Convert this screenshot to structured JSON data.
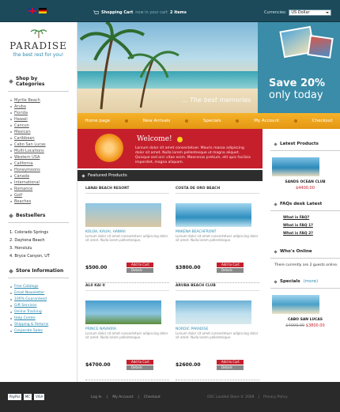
{
  "topbar": {
    "flags": [
      "uk-flag-icon",
      "de-flag-icon"
    ],
    "cart_title": "Shopping Cart",
    "cart_now": "now in your cart",
    "cart_count": "2 items",
    "currency_label": "Currencies:",
    "currency_value": "US Dollar"
  },
  "logo": {
    "brand": "PARADISE",
    "tagline": "the best rest for you!"
  },
  "sidebar": {
    "categories_title": "Shop by Categories",
    "categories": [
      "Myrtle Beach",
      "Aruba",
      "Florida",
      "Hawaii",
      "Cancun",
      "Mexican",
      "Caribbean",
      "Cabo San Lucas",
      "Multi-Locations",
      "Western USA",
      "California",
      "Honeymoons",
      "Canada",
      "International",
      "Romance",
      "Golf",
      "Beaches"
    ],
    "bestsellers_title": "Bestsellers",
    "bestsellers": [
      "1.  Colorado Springs",
      "2.  Daytona Beach",
      "3.  Honolulu",
      "4.  Bryce Canyon, UT"
    ],
    "info_title": "Store Information",
    "info": [
      "Free Catalogs",
      "Email Newsletter",
      "100% Guaranteed",
      "Gift Services",
      "Online Tracking",
      "Help Center",
      "Shipping & Returns",
      "Corporate Sales"
    ]
  },
  "banner": {
    "memories": "... The best memories",
    "save": "Save 20%",
    "only": "only today"
  },
  "nav": [
    "Home page",
    "New Arrivals",
    "Specials",
    "My Account",
    "Checkout"
  ],
  "welcome": {
    "title": "Welcome!",
    "text": "Lorsum dolor sit amet consectetuer. Mauris massa adipiscing dolor sit amet. Nulla lorem pellentesque ut magna aliquet. Quisque sed orci vitae enim. Maecenas pretium, elit quis facilisis imperdiet, magna aliquam."
  },
  "featured": {
    "title": "Featured Products",
    "products": [
      {
        "name": "LANAI BEACH RESORT",
        "desc_title": "KOLOA, KAUAI, HAWAII",
        "desc": "Lorsum dolor sit amet consectetuer adipiscing dolor sit amet. Nulla lorem pellentesque.",
        "price": "$500.00",
        "cart": "Add to Cart",
        "details": "Details",
        "img": [
          "#d9c7a4",
          "#f0e6cf"
        ]
      },
      {
        "name": "COSTA DE ORO BEACH",
        "desc_title": "MAKENA BEACHFRONT",
        "desc": "Lorsum dolor sit amet consectetuer adipiscing dolor sit amet. Nulla lorem pellentesque.",
        "price": "$3800.00",
        "cart": "Add to Cart",
        "details": "Details",
        "img": [
          "#2f8fbf",
          "#bfe3ef"
        ]
      },
      {
        "name": "ALII KAI II",
        "desc_title": "PRINCE NAVARRA",
        "desc": "Lorsum dolor sit amet consectetuer adipiscing dolor sit amet. Nulla lorem pellentesque.",
        "price": "$4700.00",
        "cart": "Add to Cart",
        "details": "Details",
        "img": [
          "#4a9fcf",
          "#5e8d3c"
        ]
      },
      {
        "name": "ARUBA BEACH CLUB",
        "desc_title": "NORDIC PARADISE",
        "desc": "Lorsum dolor sit amet consectetuer adipiscing dolor sit amet. Nulla lorem pellentesque.",
        "price": "$2600.00",
        "cart": "Add to Cart",
        "details": "Details",
        "img": [
          "#6cb1d6",
          "#d7e8ec"
        ]
      }
    ]
  },
  "right": {
    "latest_title": "Latest Products",
    "latest_caption": "SANDS OCEAN CLUB",
    "latest_price": "$4400.00",
    "faq_title": "FAQs desk Latest",
    "faqs": [
      "What is FAQ?",
      "What is FAQ 1?",
      "What is FAQ 2?"
    ],
    "online_title": "Who's Online",
    "online_text": "There currently are 2 guests online.",
    "specials_title": "Specials",
    "specials_more": "(more)",
    "specials_caption": "CABO SAN LUCAS",
    "specials_old": "$4000.00",
    "specials_new": "$3800.00"
  },
  "footer": {
    "payments": [
      "PayPal",
      "MC",
      "VISA"
    ],
    "links": [
      "Log In",
      "|",
      "My Account",
      "|",
      "Checkout"
    ],
    "copyright": "OSC Loaded Store © 2008",
    "sep": "|",
    "privacy": "Privacy Policy"
  },
  "colors": {
    "topbar": "#1c4a5a",
    "accent_orange": "#f0a51f",
    "accent_red": "#c51f2c",
    "link_blue": "#2a8ab0"
  }
}
